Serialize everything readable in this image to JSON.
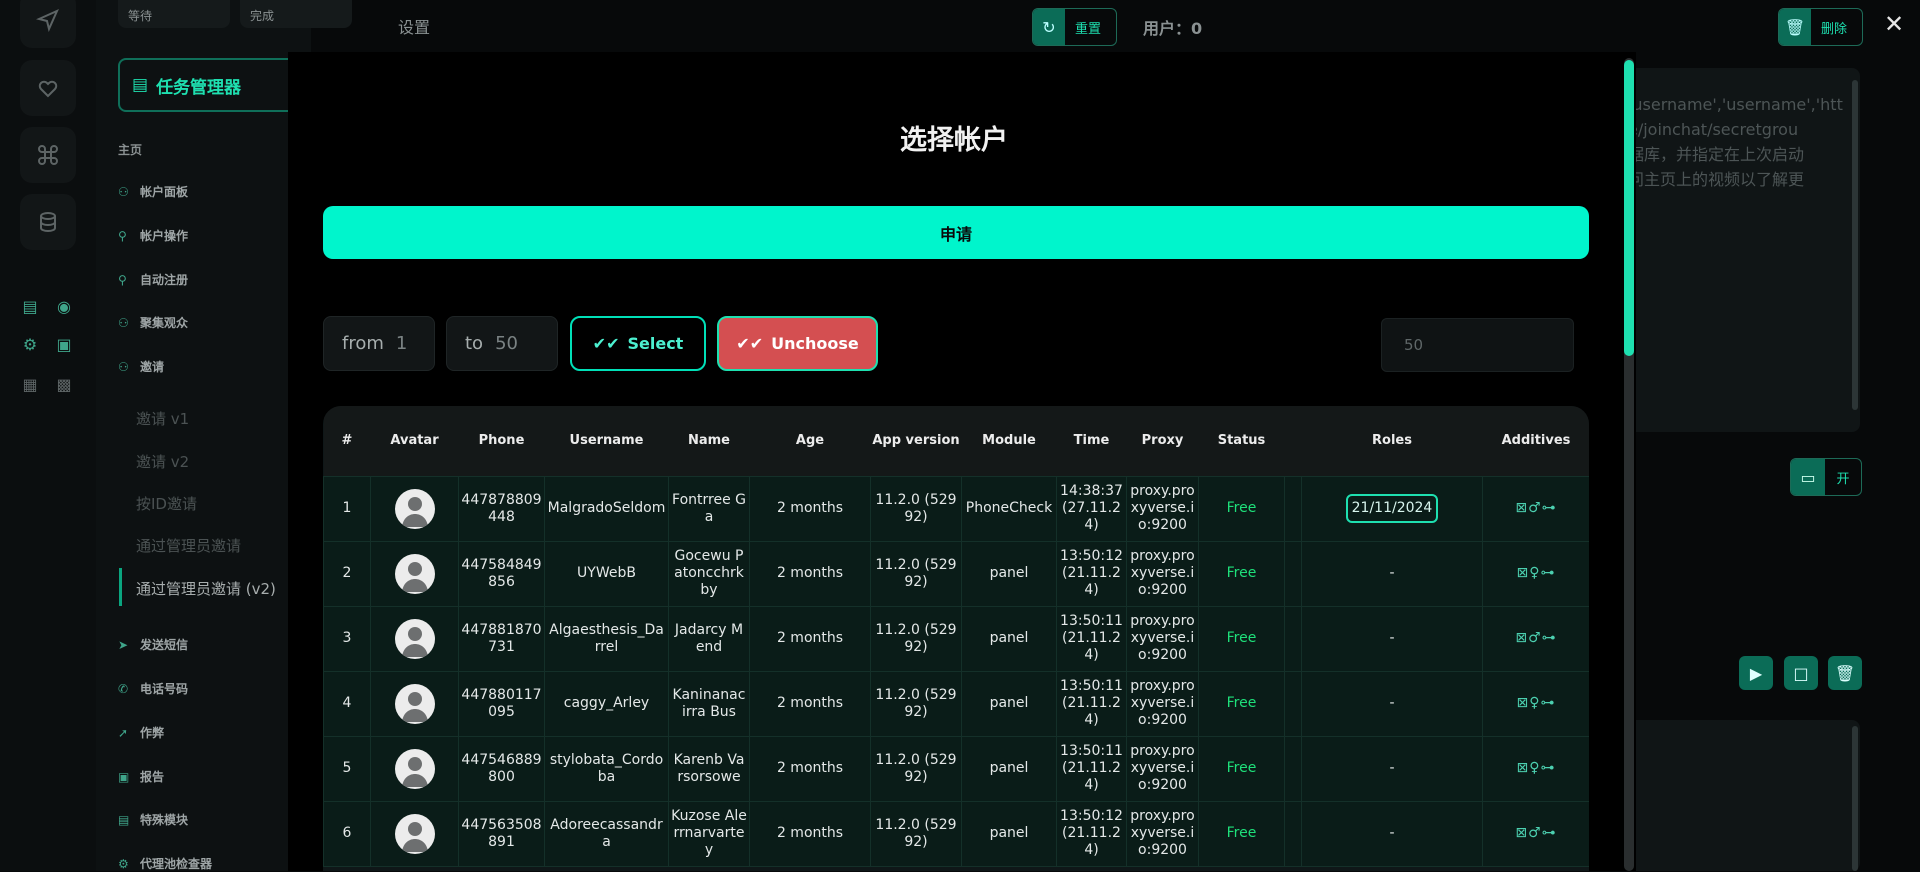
{
  "top_chips": [
    "等待",
    "完成"
  ],
  "sidebar": {
    "title": "任务管理器",
    "home": "主页",
    "items": [
      {
        "label": "帐户面板",
        "icon": "users-icon"
      },
      {
        "label": "帐户操作",
        "icon": "user-icon"
      },
      {
        "label": "自动注册",
        "icon": "user-add-icon"
      },
      {
        "label": "聚集观众",
        "icon": "users-group-icon"
      },
      {
        "label": "邀请",
        "icon": "user-invite-icon"
      }
    ],
    "sub_items": [
      "邀请 v1",
      "邀请 v2",
      "按ID邀请",
      "通过管理员邀请",
      "通过管理员邀请 (v2)"
    ],
    "items2": [
      {
        "label": "发送短信",
        "icon": "send-icon"
      },
      {
        "label": "电话号码",
        "icon": "phone-icon"
      },
      {
        "label": "作弊",
        "icon": "cheat-icon"
      },
      {
        "label": "报告",
        "icon": "report-icon"
      },
      {
        "label": "特殊模块",
        "icon": "module-icon"
      },
      {
        "label": "代理池检查器",
        "icon": "proxy-icon"
      }
    ]
  },
  "topbar": {
    "title": "设置",
    "reset_label": "重置",
    "users_label": "用户：0",
    "delete_label": "删除"
  },
  "background_text": [
    "'username','username','htt",
    "e/joinchat/secretgrou",
    "据库，并指定在上次启动",
    "问主页上的视频以了解更"
  ],
  "folder_btn_label": "开",
  "modal": {
    "title": "选择帐户",
    "apply_label": "申请",
    "from_label": "from",
    "from_value": "1",
    "to_label": "to",
    "to_value": "50",
    "select_label": "Select",
    "unchoose_label": "Unchoose",
    "count_value": "50"
  },
  "table": {
    "headers": [
      "#",
      "Avatar",
      "Phone",
      "Username",
      "Name",
      "Age",
      "App version",
      "Module",
      "Time",
      "Proxy",
      "Status",
      "",
      "Roles",
      "Additives"
    ],
    "rows": [
      {
        "n": "1",
        "phone": "447878809448",
        "username": "MalgradoSeldom",
        "name": "Fontrree Ga",
        "age": "2 months",
        "app": "11.2.0 (52992)",
        "module": "PhoneCheck",
        "time": "14:38:37 (27.11.24)",
        "proxy": "proxy.proxyverse.io:9200",
        "status": "Free",
        "role": "21/11/2024",
        "additives": "⊠♂⊶"
      },
      {
        "n": "2",
        "phone": "447584849856",
        "username": "UYWebB",
        "name": "Gocewu Patoncchrkby",
        "age": "2 months",
        "app": "11.2.0 (52992)",
        "module": "panel",
        "time": "13:50:12 (21.11.24)",
        "proxy": "proxy.proxyverse.io:9200",
        "status": "Free",
        "role": "-",
        "additives": "⊠♀⊶"
      },
      {
        "n": "3",
        "phone": "447881870731",
        "username": "Algaesthesis_Darrel",
        "name": "Jadarcy Mend",
        "age": "2 months",
        "app": "11.2.0 (52992)",
        "module": "panel",
        "time": "13:50:11(21.11.24)",
        "proxy": "proxy.proxyverse.io:9200",
        "status": "Free",
        "role": "-",
        "additives": "⊠♂⊶"
      },
      {
        "n": "4",
        "phone": "447880117095",
        "username": "caggy_Arley",
        "name": "Kaninanacirra Bus",
        "age": "2 months",
        "app": "11.2.0 (52992)",
        "module": "panel",
        "time": "13:50:11(21.11.24)",
        "proxy": "proxy.proxyverse.io:9200",
        "status": "Free",
        "role": "-",
        "additives": "⊠♀⊶"
      },
      {
        "n": "5",
        "phone": "447546889800",
        "username": "stylobata_Cordoba",
        "name": "Karenb Varsorsowe",
        "age": "2 months",
        "app": "11.2.0 (52992)",
        "module": "panel",
        "time": "13:50:11(21.11.24)",
        "proxy": "proxy.proxyverse.io:9200",
        "status": "Free",
        "role": "-",
        "additives": "⊠♀⊶"
      },
      {
        "n": "6",
        "phone": "447563508891",
        "username": "Adoreecassandra",
        "name": "Kuzose Alerrnarvartey",
        "age": "2 months",
        "app": "11.2.0 (52992)",
        "module": "panel",
        "time": "13:50:12 (21.11.24)",
        "proxy": "proxy.proxyverse.io:9200",
        "status": "Free",
        "role": "-",
        "additives": "⊠♂⊶"
      }
    ]
  },
  "colors": {
    "accent": "#00f5cc",
    "danger": "#d44f51",
    "free": "#1ee07a"
  }
}
